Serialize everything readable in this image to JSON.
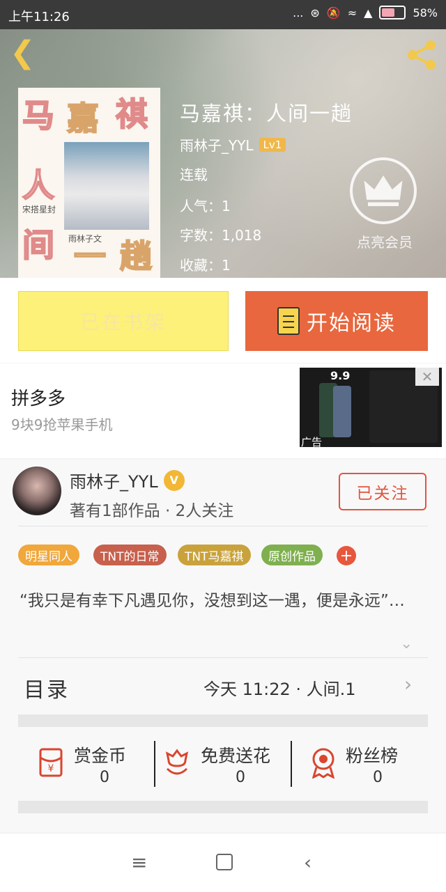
{
  "status_bar": {
    "time": "上午11:26",
    "dots": "...",
    "battery": "58%"
  },
  "header": {
    "book_title": "马嘉祺：人间一趟",
    "author": "雨林子_YYL",
    "level": "Lv1",
    "status": "连载",
    "popularity": "人气：1",
    "word_count": "字数：1,018",
    "favorites": "收藏：1",
    "vip_label": "点亮会员"
  },
  "cover": {
    "ch1": "马",
    "ch2": "嘉",
    "ch3": "祺",
    "ch4": "人",
    "ch5": "间",
    "ch6": "一",
    "ch7": "趟",
    "small1": "宋搭星封",
    "small2": "雨林子文"
  },
  "actions": {
    "shelf_label": "已在书架",
    "read_label": "开始阅读"
  },
  "ad": {
    "title": "拼多多",
    "subtitle": "9块9抢苹果手机",
    "tag": "广告",
    "price_text": "9.9"
  },
  "author_card": {
    "name": "雨林子_YYL",
    "badge": "V",
    "info": "著有1部作品 · 2人关注",
    "follow_label": "已关注",
    "tags": [
      "明星同人",
      "TNT的日常",
      "TNT马嘉祺",
      "原创作品"
    ],
    "tag_colors": [
      "#f0a73b",
      "#c7604c",
      "#c9a23c",
      "#7fb04f"
    ],
    "plus": "+",
    "intro": "“我只是有幸下凡遇见你，没想到这一遇，便是永远”…"
  },
  "toc": {
    "label": "目录",
    "latest": "今天 11:22 · 人间.1"
  },
  "stats": [
    {
      "label": "赏金币",
      "value": "0",
      "icon": "red-envelope-icon"
    },
    {
      "label": "免费送花",
      "value": "0",
      "icon": "flower-icon"
    },
    {
      "label": "粉丝榜",
      "value": "0",
      "icon": "medal-icon"
    }
  ],
  "colors": {
    "accent": "#e8673e",
    "shelf": "#fdf17a",
    "icon_red": "#d9452f"
  }
}
